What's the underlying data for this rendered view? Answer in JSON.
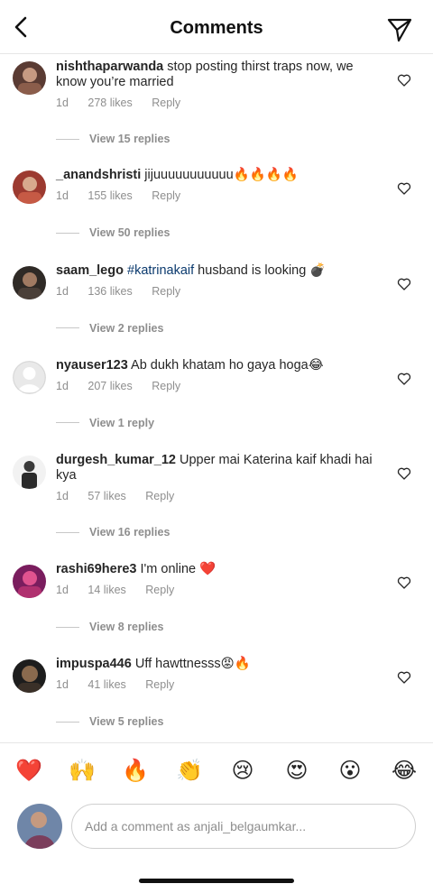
{
  "header": {
    "title": "Comments",
    "back_icon": "chevron-left-icon",
    "send_icon": "paper-plane-icon"
  },
  "comments": [
    {
      "username": "nishthaparwanda",
      "text": " stop posting thirst traps now, we know you’re married",
      "time": "1d",
      "likes": "278 likes",
      "reply": "Reply",
      "view_replies": "View 15 replies"
    },
    {
      "username": "_anandshristi",
      "text": " jijuuuuuuuuuuu🔥🔥🔥🔥",
      "time": "1d",
      "likes": "155 likes",
      "reply": "Reply",
      "view_replies": "View 50 replies"
    },
    {
      "username": "saam_lego",
      "hashtag": "#katrinakaif",
      "text": " husband is looking 💣",
      "time": "1d",
      "likes": "136 likes",
      "reply": "Reply",
      "view_replies": "View 2 replies"
    },
    {
      "username": "nyauser123",
      "text": " Ab dukh khatam ho gaya hoga😂",
      "time": "1d",
      "likes": "207 likes",
      "reply": "Reply",
      "view_replies": "View 1 reply"
    },
    {
      "username": "durgesh_kumar_12",
      "text": " Upper mai Katerina kaif khadi hai kya",
      "time": "1d",
      "likes": "57 likes",
      "reply": "Reply",
      "view_replies": "View 16 replies"
    },
    {
      "username": "rashi69here3",
      "text": " I'm online ❤️",
      "time": "1d",
      "likes": "14 likes",
      "reply": "Reply",
      "view_replies": "View 8 replies"
    },
    {
      "username": "impuspa446",
      "text": " Uff hawttnesss😡🔥",
      "time": "1d",
      "likes": "41 likes",
      "reply": "Reply",
      "view_replies": "View 5 replies"
    }
  ],
  "reactions": [
    "❤️",
    "🙌",
    "🔥",
    "👏",
    "😢",
    "😍",
    "😮",
    "😂"
  ],
  "composer": {
    "placeholder": "Add a comment as anjali_belgaumkar..."
  }
}
